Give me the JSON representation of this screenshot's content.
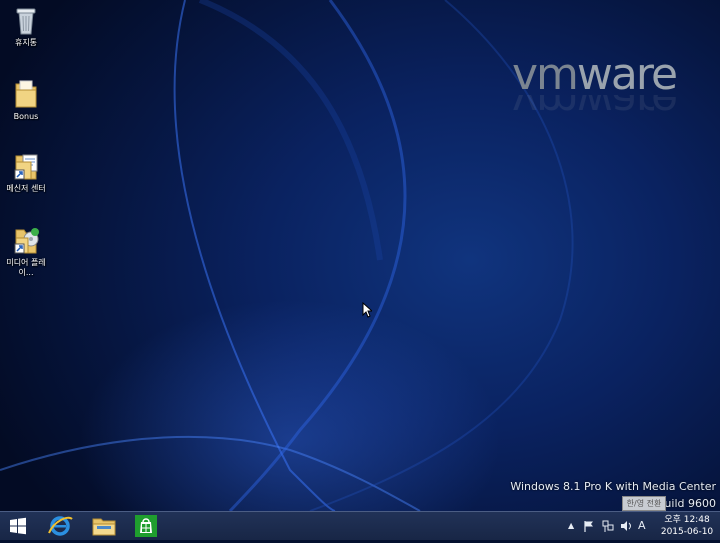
{
  "desktop": {
    "icons": [
      {
        "label": "휴지통",
        "icon": "recycle-bin-icon"
      },
      {
        "label": "Bonus",
        "icon": "folder-icon"
      },
      {
        "label": "메신저 센터",
        "icon": "folder-shortcut-icon"
      },
      {
        "label": "미디어 플레이...",
        "icon": "media-player-shortcut-icon"
      }
    ],
    "brand": {
      "vm": "vm",
      "ware": "ware"
    },
    "watermark": {
      "line1": "Windows 8.1 Pro K with Media Center",
      "line2": "Build 9600"
    },
    "ime_tooltip": "한/영 전환"
  },
  "taskbar": {
    "pinned": [
      {
        "name": "start",
        "icon": "windows-logo-icon"
      },
      {
        "name": "internet-explorer",
        "icon": "ie-icon"
      },
      {
        "name": "file-explorer",
        "icon": "folder-icon"
      },
      {
        "name": "store",
        "icon": "store-icon"
      }
    ],
    "tray": {
      "show_hidden": "▲",
      "input_indicator": "A"
    },
    "clock": {
      "time": "오후 12:48",
      "date": "2015-06-10"
    },
    "colors": {
      "taskbar": "#1c2b4c",
      "store": "#1f9e2e",
      "ie": "#2b8fe0"
    }
  }
}
